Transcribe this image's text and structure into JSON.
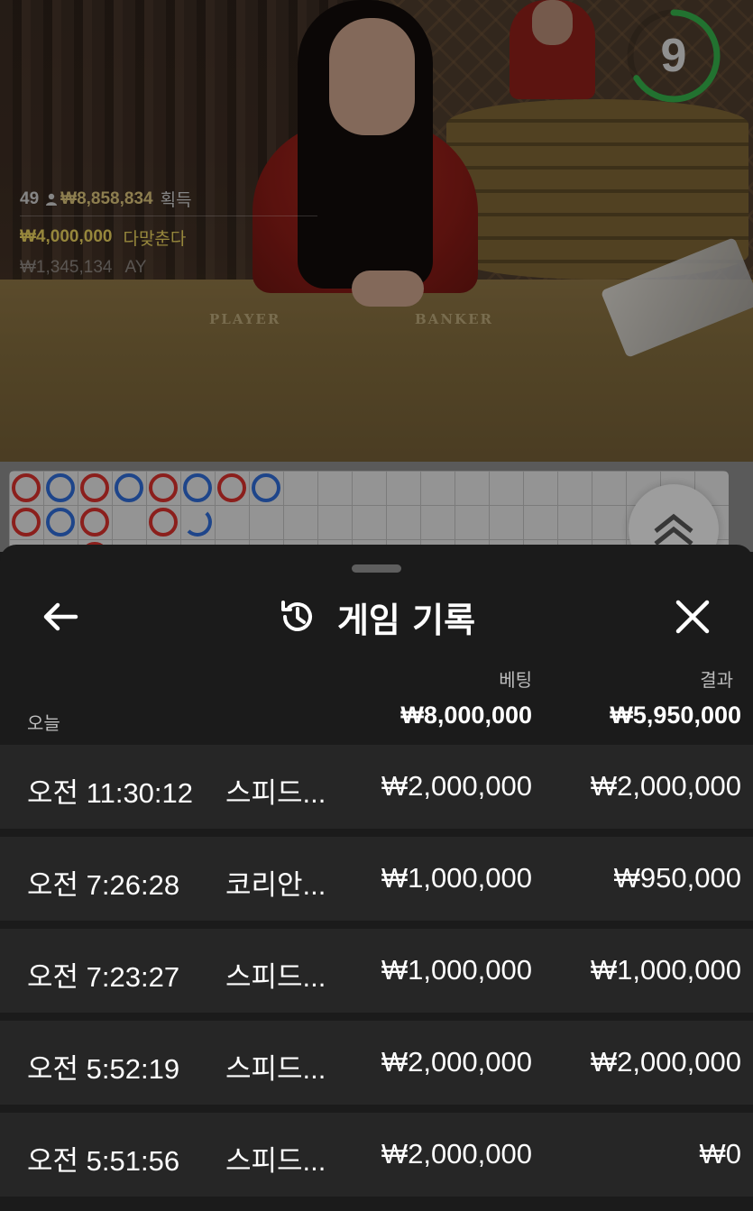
{
  "video": {
    "timer": "9",
    "table_labels": {
      "player": "PLAYER",
      "banker": "BANKER"
    },
    "winners": {
      "count": "49",
      "count_icon": "person-icon",
      "total": "₩8,858,834",
      "total_label": "획득",
      "top_amount": "₩4,000,000",
      "top_name": "다맞춘다",
      "second_amount": "₩1,345,134",
      "second_name": "AY"
    }
  },
  "sheet": {
    "title": "게임 기록",
    "title_icon": "history-icon",
    "back_icon": "arrow-left-icon",
    "close_icon": "close-icon",
    "col_bet": "베팅",
    "col_result": "결과",
    "today_label": "오늘",
    "total_bet": "₩8,000,000",
    "total_result": "₩5,950,000",
    "rows": [
      {
        "time": "오전 11:30:12",
        "game": "스피드...",
        "bet": "₩2,000,000",
        "result": "₩2,000,000"
      },
      {
        "time": "오전 7:26:28",
        "game": "코리안...",
        "bet": "₩1,000,000",
        "result": "₩950,000"
      },
      {
        "time": "오전 7:23:27",
        "game": "스피드...",
        "bet": "₩1,000,000",
        "result": "₩1,000,000"
      },
      {
        "time": "오전 5:52:19",
        "game": "스피드...",
        "bet": "₩2,000,000",
        "result": "₩2,000,000"
      },
      {
        "time": "오전 5:51:56",
        "game": "스피드...",
        "bet": "₩2,000,000",
        "result": "₩0"
      }
    ]
  },
  "colors": {
    "player": "#2f6bd4",
    "banker": "#d6302b",
    "timer": "#35b04a",
    "winner_gold": "#e6cf5c"
  }
}
